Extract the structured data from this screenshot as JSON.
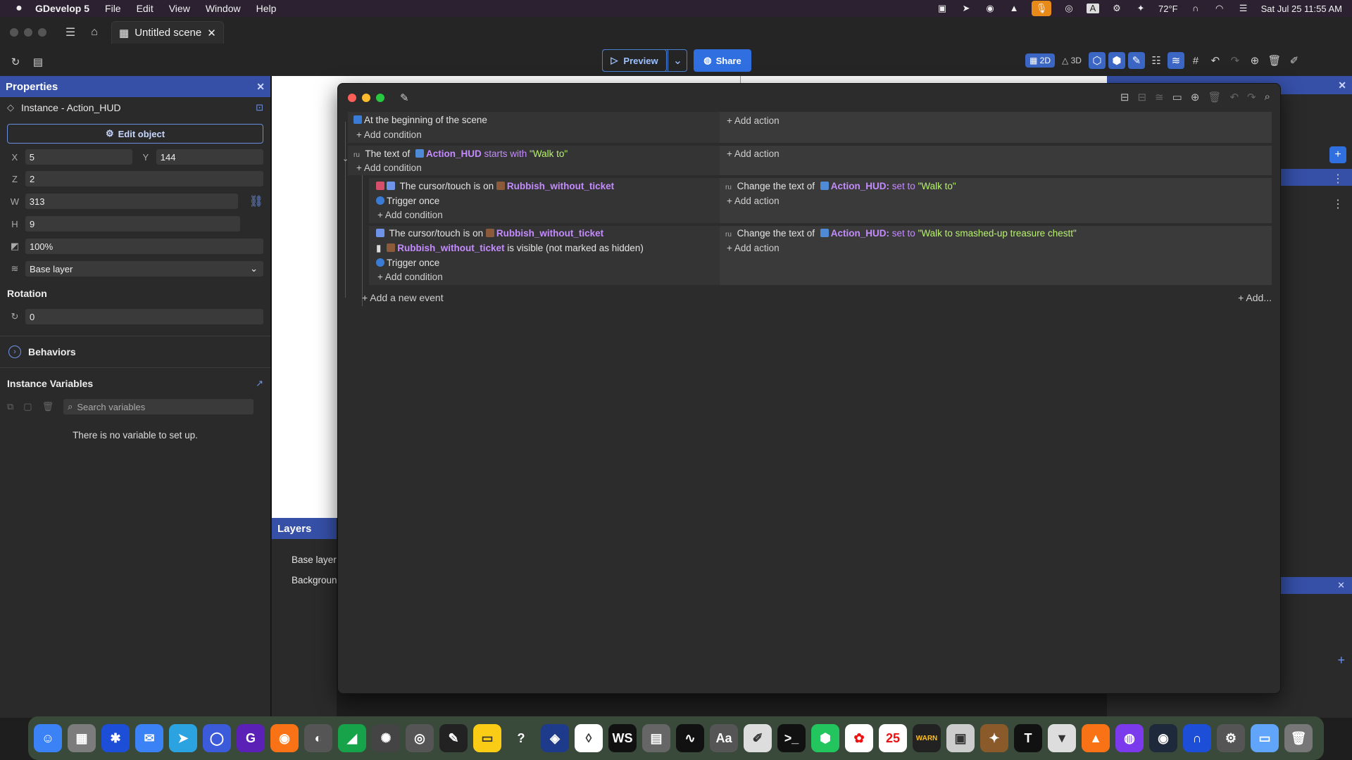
{
  "menubar": {
    "app_name": "GDevelop 5",
    "menus": [
      "File",
      "Edit",
      "View",
      "Window",
      "Help"
    ],
    "weather": "72°F",
    "clock": "Sat Jul 25  11:55 AM"
  },
  "tabs": {
    "scene_tab": "Untitled scene"
  },
  "toolbar": {
    "preview_label": "Preview",
    "share_label": "Share",
    "mode_2d": "2D",
    "mode_3d": "3D"
  },
  "properties": {
    "title": "Properties",
    "instance_title": "Instance  -  Action_HUD",
    "edit_object": "Edit object",
    "x_label": "X",
    "x_value": "5",
    "y_label": "Y",
    "y_value": "144",
    "z_label": "Z",
    "z_value": "2",
    "w_label": "W",
    "w_value": "313",
    "h_label": "H",
    "h_value": "9",
    "opacity_value": "100%",
    "layer_value": "Base layer",
    "rotation_title": "Rotation",
    "rotation_value": "0",
    "behaviors": "Behaviors",
    "instance_variables": "Instance Variables",
    "search_placeholder": "Search variables",
    "no_variable": "There is no variable to set up."
  },
  "layers": {
    "title": "Layers",
    "items": [
      "Base layer",
      "Backgroun"
    ]
  },
  "events": {
    "e1_cond": "At the beginning of the scene",
    "add_condition": "+ Add condition",
    "add_action": "+ Add action",
    "e2_cond_prefix": "The text of",
    "e2_obj": "Action_HUD",
    "e2_kw": "starts with",
    "e2_str": "\"Walk to\"",
    "e3_cond_prefix": "The cursor/touch is on",
    "e3_obj": "Rubbish_without_ticket",
    "trigger_once": "Trigger once",
    "act_prefix": "Change the text of",
    "act_obj": "Action_HUD:",
    "act_kw": "set to",
    "e3_act_str": "\"Walk to\"",
    "e4_vis_obj": "Rubbish_without_ticket",
    "e4_vis_text": "is visible (not marked as hidden)",
    "e4_act_str": "\"Walk to smashed-up treasure chestt\"",
    "add_event": "+ Add a new event",
    "add_more": "+ Add..."
  },
  "colors": {
    "accent": "#3650a8",
    "object_purple": "#c48bff",
    "string_green": "#b7f26c"
  }
}
